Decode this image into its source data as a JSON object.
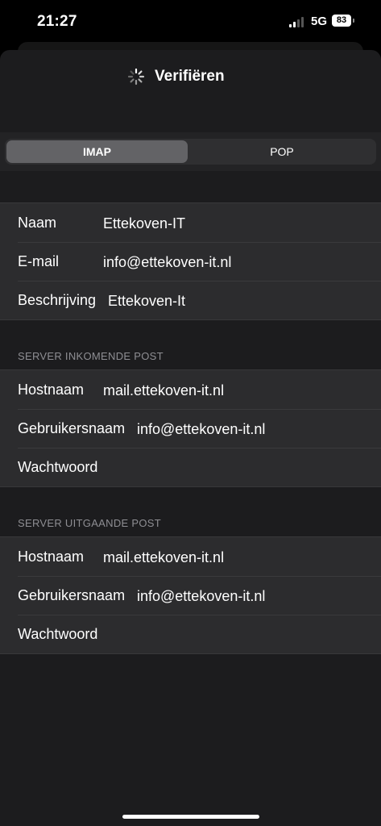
{
  "status_bar": {
    "time": "21:27",
    "network": "5G",
    "battery": "83",
    "icons": [
      "cellular-signal-icon",
      "battery-icon"
    ]
  },
  "nav": {
    "title": "Verifiëren",
    "spinner_icon": "activity-spinner-icon"
  },
  "account_type": {
    "options": [
      "IMAP",
      "POP"
    ],
    "selected": "IMAP"
  },
  "account": {
    "rows": [
      {
        "label": "Naam",
        "value": "Ettekoven-IT"
      },
      {
        "label": "E-mail",
        "value": "info@ettekoven-it.nl"
      },
      {
        "label": "Beschrijving",
        "value": "Ettekoven-It"
      }
    ]
  },
  "incoming": {
    "header": "SERVER INKOMENDE POST",
    "rows": [
      {
        "label": "Hostnaam",
        "value": "mail.ettekoven-it.nl"
      },
      {
        "label": "Gebruikersnaam",
        "value": "info@ettekoven-it.nl"
      },
      {
        "label": "Wachtwoord",
        "value": ""
      }
    ]
  },
  "outgoing": {
    "header": "SERVER UITGAANDE POST",
    "rows": [
      {
        "label": "Hostnaam",
        "value": "mail.ettekoven-it.nl"
      },
      {
        "label": "Gebruikersnaam",
        "value": "info@ettekoven-it.nl"
      },
      {
        "label": "Wachtwoord",
        "value": ""
      }
    ]
  },
  "colors": {
    "background": "#1c1c1e",
    "cell": "#2c2c2e",
    "secondary_text": "#8e8e93",
    "segment_selected": "#636366"
  }
}
